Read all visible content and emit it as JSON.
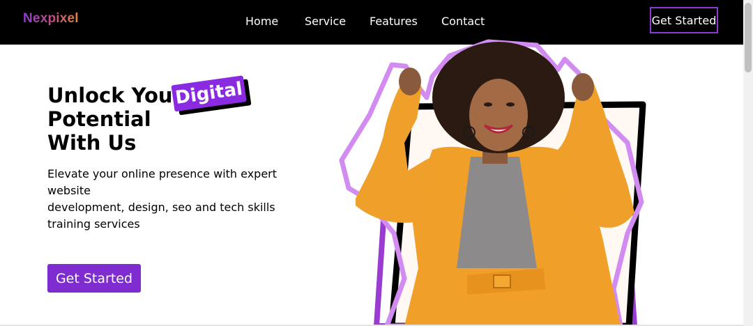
{
  "brand": {
    "logo_text": "Nexpixel"
  },
  "nav": {
    "items": [
      {
        "label": "Home"
      },
      {
        "label": "Service"
      },
      {
        "label": "Features"
      },
      {
        "label": "Contact"
      }
    ],
    "cta_label": "Get Started"
  },
  "hero": {
    "headline_line1": "Unlock Your",
    "headline_line2": "Potential",
    "headline_line3": "With Us",
    "highlight_word": "Digital",
    "subtext_line1": "Elevate your online presence with expert",
    "subtext_line2": "website",
    "subtext_line3": "development, design, seo and tech skills",
    "subtext_line4": "training services",
    "cta_label": "Get Started"
  },
  "colors": {
    "nav_bg": "#000000",
    "accent": "#8a2be2",
    "cta_bg": "#7e2bcf",
    "logo_gradient_start": "#8e3ccf",
    "logo_gradient_end": "#e08a3a"
  },
  "hero_image": {
    "icon": "woman-celebrating-illustration"
  }
}
